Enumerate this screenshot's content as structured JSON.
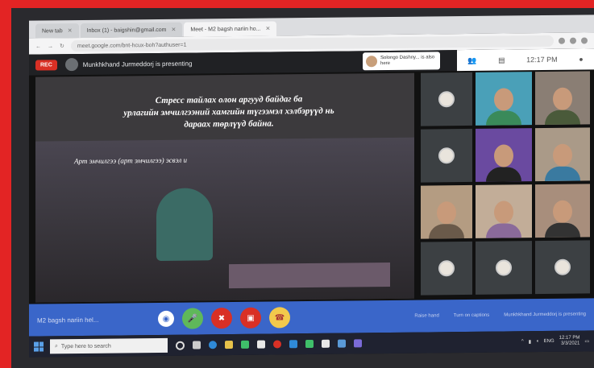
{
  "browser": {
    "tabs": [
      {
        "label": "New tab"
      },
      {
        "label": "Inbox (1) - baigshin@gmail.com"
      },
      {
        "label": "Meet - M2 bagsh nariin ho..."
      }
    ],
    "url": "meet.google.com/bnt-hcux-boh?authuser=1"
  },
  "meet": {
    "rec_label": "REC",
    "presenting_text": "Munkhkhand Jurmeddorj is presenting",
    "also_here": "Solongo Dashny... is also here",
    "time": "12:17 PM",
    "meeting_name": "M2 bagsh nariin hel...",
    "right_controls": [
      "Raise hand",
      "Turn on captions",
      "Munkhkhand Jurmeddorj is presenting"
    ]
  },
  "slide": {
    "title_lines": [
      "Стресс тайлах олон аргууд  байдаг ба",
      "урлагийн эмчилгээний хамгийн түгээмэл хэлбэрүүд нь",
      "дараах  төрлүүд байна."
    ],
    "subtitle": "Арт эмчилгээ (арт эмчилгээ) эсвэл и"
  },
  "taskbar": {
    "search_placeholder": "Type here to search",
    "language": "ENG",
    "clock_time": "12:17 PM",
    "clock_date": "3/3/2021"
  },
  "colors": {
    "frame_red": "#e32424",
    "controls_blue": "#3a66c9",
    "mic_green": "#5fb85a",
    "end_red": "#d93025",
    "hand_yellow": "#f2c94c"
  }
}
